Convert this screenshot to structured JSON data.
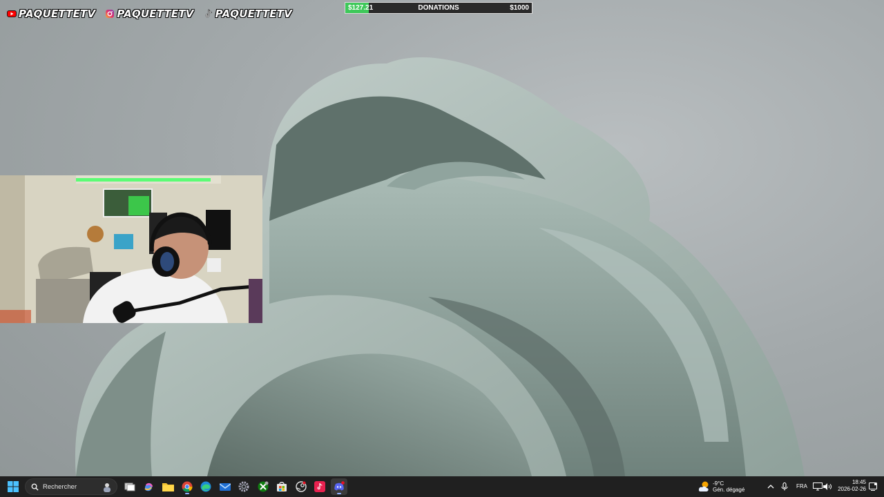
{
  "overlay": {
    "socials": [
      {
        "platform": "youtube-icon",
        "handle": "PAQUETTETV"
      },
      {
        "platform": "instagram-icon",
        "handle": "PAQUETTETV"
      },
      {
        "platform": "tiktok-icon",
        "handle": "PAQUETTETV"
      }
    ],
    "donations": {
      "current": "$127.21",
      "label": "DONATIONS",
      "goal": "$1000",
      "progress_fraction": 0.127,
      "bar_color": "#3ec95a"
    }
  },
  "webcam": {
    "description_hidden": true
  },
  "taskbar": {
    "search_placeholder": "Rechercher",
    "apps": [
      "start-icon",
      "task-view-icon",
      "copilot-icon",
      "file-explorer-icon",
      "chrome-icon",
      "edge-icon",
      "mail-icon",
      "settings-icon",
      "xbox-icon",
      "store-icon",
      "steam-icon",
      "tiktok-app-icon",
      "discord-icon"
    ],
    "weather": {
      "temp": "-9°C",
      "condition": "Gén. dégagé"
    },
    "language": "FRA",
    "time": "18:45",
    "date": "2026-02-26"
  },
  "colors": {
    "taskbar": "#202020",
    "accent": "#8fb0ff"
  }
}
